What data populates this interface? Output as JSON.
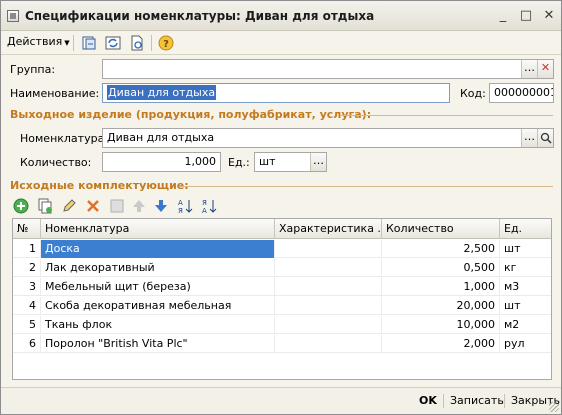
{
  "window": {
    "title": "Спецификации номенклатуры: Диван для отдыха",
    "controls": {
      "minimize": "_",
      "maximize": "□",
      "close": "✕"
    }
  },
  "toolbar": {
    "actions_label": "Действия",
    "icons": [
      "save-copy-icon",
      "refresh-icon",
      "document-icon",
      "help-icon"
    ]
  },
  "form": {
    "group_label": "Группа:",
    "group_value": "",
    "name_label": "Наименование:",
    "name_value": "Диван для отдыха",
    "code_label": "Код:",
    "code_value": "000000001",
    "output_section_title": "Выходное изделие (продукция, полуфабрикат, услуга):",
    "nomenclature_label": "Номенклатура:",
    "nomenclature_value": "Диван для отдыха",
    "quantity_label": "Количество:",
    "quantity_value": "1,000",
    "unit_label": "Ед.:",
    "unit_value": "шт",
    "components_section_title": "Исходные комплектующие:"
  },
  "table": {
    "columns": [
      "№",
      "Номенклатура",
      "Характеристика ...",
      "Количество",
      "Ед."
    ],
    "rows": [
      {
        "n": "1",
        "name": "Доска",
        "characteristic": "",
        "qty": "2,500",
        "unit": "шт"
      },
      {
        "n": "2",
        "name": "Лак декоративный",
        "characteristic": "",
        "qty": "0,500",
        "unit": "кг"
      },
      {
        "n": "3",
        "name": "Мебельный щит (береза)",
        "characteristic": "",
        "qty": "1,000",
        "unit": "м3"
      },
      {
        "n": "4",
        "name": "Скоба декоративная мебельная",
        "characteristic": "",
        "qty": "20,000",
        "unit": "шт"
      },
      {
        "n": "5",
        "name": "Ткань флок",
        "characteristic": "",
        "qty": "10,000",
        "unit": "м2"
      },
      {
        "n": "6",
        "name": "Поролон \"British Vita Plc\"",
        "characteristic": "",
        "qty": "2,000",
        "unit": "рул"
      }
    ]
  },
  "footer": {
    "ok_label": "OK",
    "save_label": "Записать",
    "close_label": "Закрыть"
  },
  "colors": {
    "section_title": "#c47a1f",
    "selection": "#3b7fd1"
  }
}
